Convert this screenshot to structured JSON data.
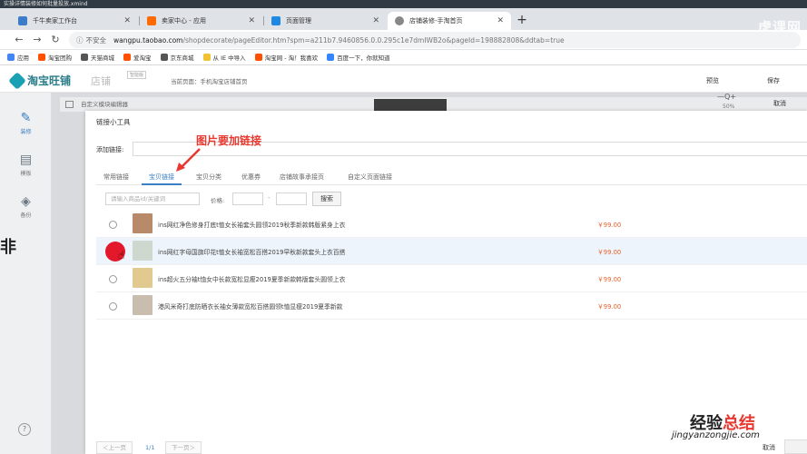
{
  "window_title": "实操详情装修如何批量投放.xmind",
  "browser": {
    "tabs": [
      {
        "label": "千牛卖家工作台",
        "fav_color": "#3d7cc9"
      },
      {
        "label": "卖家中心 - 应用",
        "fav_color": "#ff6a00"
      },
      {
        "label": "页面管理",
        "fav_color": "#1e88e5"
      },
      {
        "label": "店铺装修-手淘首页",
        "fav_color": "#888888"
      }
    ],
    "new_tab": "+",
    "url": {
      "security": "不安全",
      "host": "wangpu.taobao.com",
      "path": "/shopdecorate/pageEditor.htm?spm=a211b7.9460856.0.0.295c1e7dmIWB2o&pageId=198882808&ddtab=true"
    },
    "bookmarks": [
      {
        "label": "应用",
        "color": "#4285f4"
      },
      {
        "label": "淘宝团购",
        "color": "#ff5000"
      },
      {
        "label": "天猫商城",
        "color": "#555555"
      },
      {
        "label": "爱淘宝",
        "color": "#ff5000"
      },
      {
        "label": "京东商城",
        "color": "#555555"
      },
      {
        "label": "从 IE 中导入",
        "color": "#f1c232"
      },
      {
        "label": "淘宝网 - 淘！我喜欢",
        "color": "#ff5000"
      },
      {
        "label": "百度一下，你就知道",
        "color": "#3385ff"
      }
    ],
    "watermark_top": "虎课网"
  },
  "app": {
    "logo": "淘宝旺铺",
    "logo_sub": "店铺",
    "version_badge": "智能版",
    "current_page": "当前页面：手机淘宝店铺首页",
    "preview": "预览",
    "save": "保存",
    "cancel": "取消",
    "zoom_icon": "—Q+",
    "zoom_pct": "50%",
    "editor_label": "自定义模块编辑器",
    "sidebar": [
      {
        "label": "装修",
        "icon": "brush-icon"
      },
      {
        "label": "模板",
        "icon": "template-icon"
      },
      {
        "label": "备份",
        "icon": "backup-icon"
      }
    ],
    "help": "?"
  },
  "dialog": {
    "title": "链接小工具",
    "add_link_label": "添加链接:",
    "annotation": "图片要加链接",
    "tabs": [
      "常用链接",
      "宝贝链接",
      "宝贝分类",
      "优惠券",
      "店铺故事承接页",
      "自定义页面链接"
    ],
    "active_tab": 1,
    "search": {
      "keyword_placeholder": "请输入商品id/关键词",
      "price_label": "价格:",
      "dash": "-",
      "button": "搜索"
    },
    "items": [
      {
        "title": "ins网红净色修身打底t恤女长袖套头圆领2019秋季新款韩版紧身上衣",
        "price": "￥99.00",
        "thumb": "#b98a6a"
      },
      {
        "title": "ins网红字母国旗印花t恤女长袖宽松百搭2019早秋新款套头上衣百搭",
        "price": "￥99.00",
        "thumb": "#cfd8cf"
      },
      {
        "title": "ins超火五分袖t恤女中长款宽松显瘦2019夏季新款韩版套头圆领上衣",
        "price": "￥99.00",
        "thumb": "#e2c98f"
      },
      {
        "title": "港风米奇打底防晒衣长袖女薄款宽松百搭圆领t恤显瘦2019夏季新款",
        "price": "￥99.00",
        "thumb": "#c9bdb0"
      }
    ],
    "pager": {
      "prev": "＜上一页",
      "page": "1/1",
      "next": "下一页＞"
    },
    "cancel": "取消"
  },
  "watermark_bottom": {
    "part1": "经验",
    "accent": "总结",
    "url": "jingyanzongjie.com"
  },
  "left_edge_glyph": "非"
}
